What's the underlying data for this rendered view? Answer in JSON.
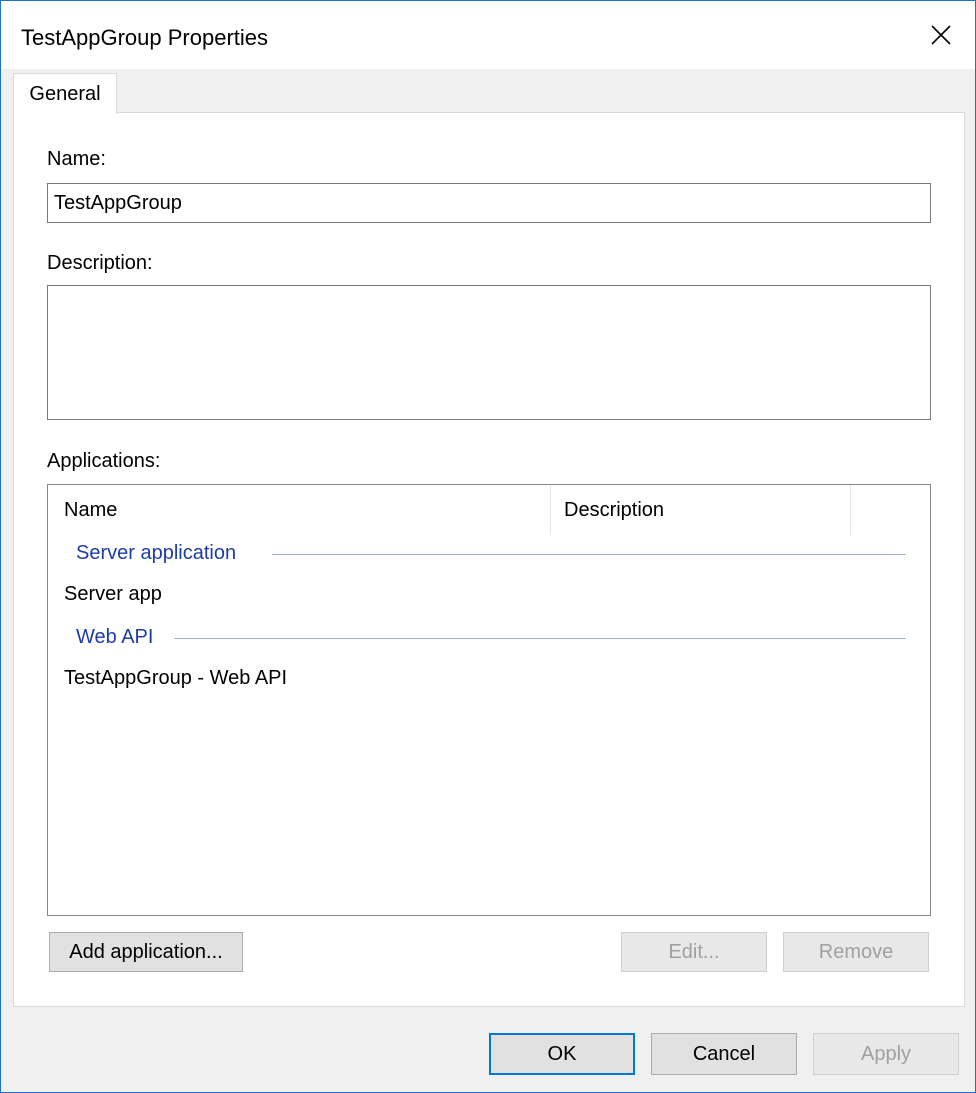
{
  "window": {
    "title": "TestAppGroup Properties"
  },
  "tabs": [
    {
      "label": "General"
    }
  ],
  "form": {
    "name_label": "Name:",
    "name_value": "TestAppGroup",
    "description_label": "Description:",
    "description_value": "",
    "applications_label": "Applications:"
  },
  "applications": {
    "columns": [
      {
        "label": "Name"
      },
      {
        "label": "Description"
      }
    ],
    "groups": [
      {
        "name": "Server application",
        "items": [
          {
            "name": "Server app",
            "description": ""
          }
        ]
      },
      {
        "name": "Web API",
        "items": [
          {
            "name": "TestAppGroup - Web API",
            "description": ""
          }
        ]
      }
    ]
  },
  "list_buttons": {
    "add": "Add application...",
    "edit": "Edit...",
    "remove": "Remove"
  },
  "dialog_buttons": {
    "ok": "OK",
    "cancel": "Cancel",
    "apply": "Apply"
  },
  "colors": {
    "accent": "#0078d7",
    "group_header": "#1e3ca8",
    "window_border": "#1e72c8"
  }
}
